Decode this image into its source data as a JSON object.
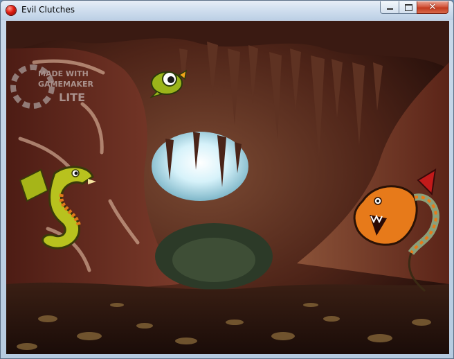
{
  "window": {
    "title": "Evil Clutches",
    "controls": {
      "minimize": "minimize",
      "maximize": "maximize",
      "close": "close"
    },
    "close_glyph": "✕"
  },
  "game": {
    "watermark": {
      "line1": "MADE WITH",
      "line2": "GAMEMAKER",
      "line3": "LITE"
    },
    "characters": [
      "player-dragon",
      "baby-dragon",
      "boss-dragon"
    ],
    "colors": {
      "cave_dark": "#2e1410",
      "cave_mid": "#6a3524",
      "cave_light": "#9a6a4c",
      "sky_opening": "#cfeef7",
      "player_green": "#b8c21e",
      "boss_orange": "#e77a1a"
    }
  }
}
